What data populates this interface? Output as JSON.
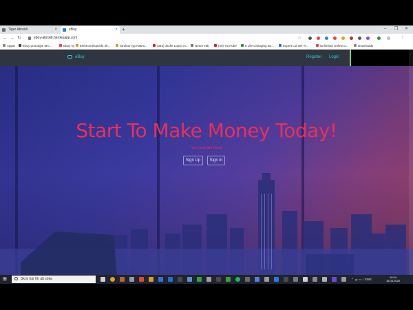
{
  "browser": {
    "tabs": [
      {
        "label": "Tiger Abroidi"
      },
      {
        "label": "eBuy"
      }
    ],
    "url": "ebuy-abroidi.herokuapp.com",
    "bookmarks": [
      "Appar",
      "Ebuy prototype Mo...",
      "Ebay ny",
      "Elektromekaniskt 3h...",
      "Struktur typ Nätnu...",
      "(345) Jacke Löpsn m...",
      "Neuer Tab",
      "(45) YouTube",
      "5 Life Changing Bo...",
      "Expert Ltd OR Tr...",
      "Unlimited Online D...",
      "Downloads"
    ]
  },
  "site": {
    "brand": "eBuy",
    "nav": {
      "register": "Register",
      "login": "Login"
    },
    "hero": {
      "title": "Start To Make Money Today!",
      "subtitle": "You Just Bet Now!",
      "signup": "Sign Up",
      "signin": "Sign In"
    }
  },
  "taskbar": {
    "search_placeholder": "Skriv här för att söka",
    "tray": "SWE",
    "time": "10:34",
    "date": "16.03.2020"
  },
  "colors": {
    "accent": "#e8305a",
    "nav_link": "#2fc7d2",
    "navbar": "#2f3642"
  }
}
